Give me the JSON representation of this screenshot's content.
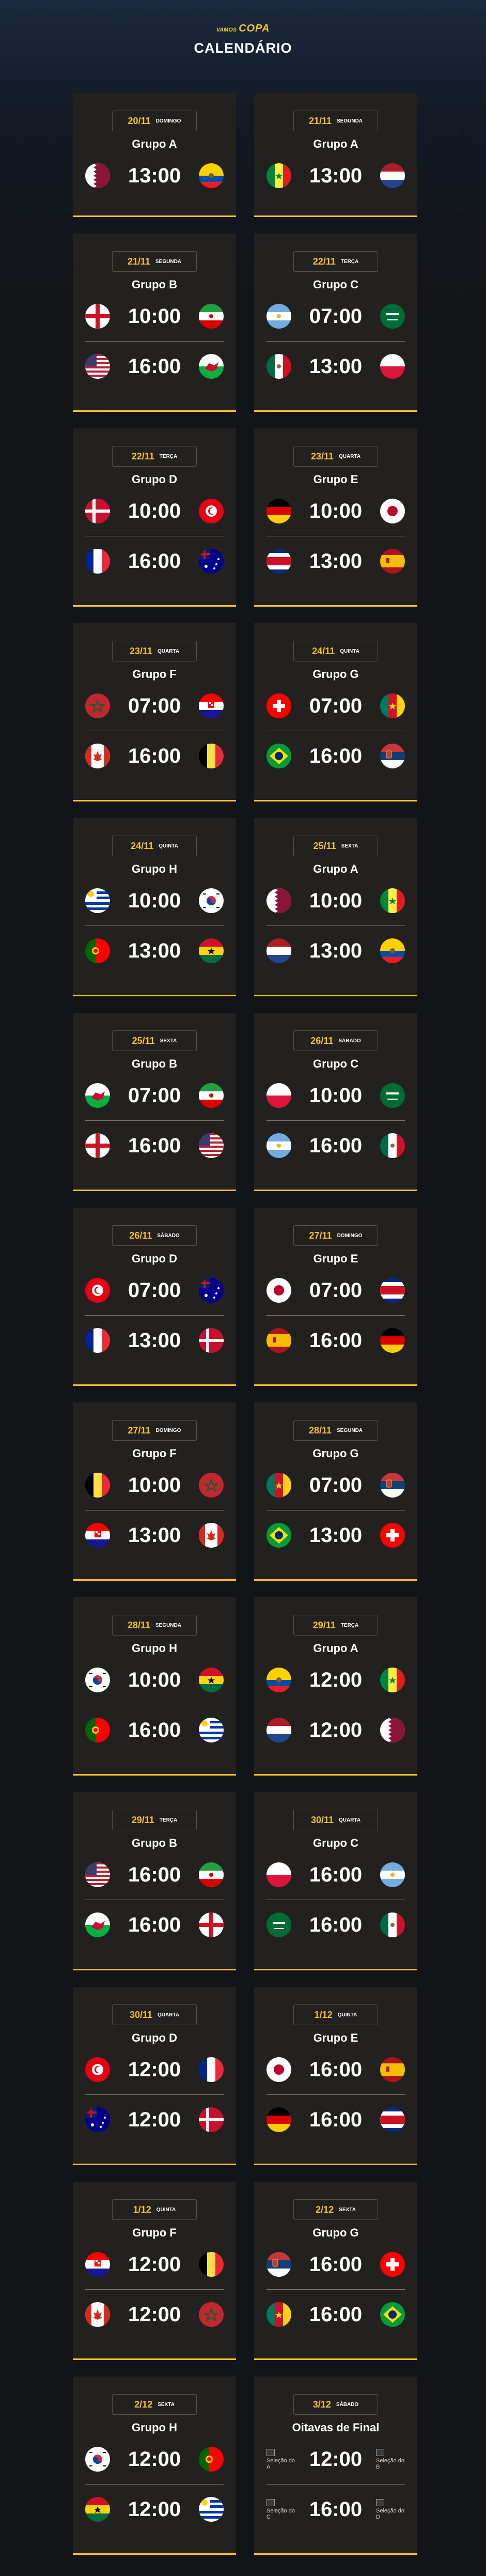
{
  "header": {
    "logo_small": "VAMOS",
    "logo_big": "COPA",
    "title": "CALENDÁRIO"
  },
  "colors": {
    "accent": "#f2c230",
    "card_bg": "#232120",
    "page_bg": "#131417"
  },
  "cards": [
    {
      "date": "20/11",
      "weekday": "DOMINGO",
      "group": "Grupo A",
      "matches": [
        {
          "home": "qatar",
          "time": "13:00",
          "away": "ecuador"
        }
      ]
    },
    {
      "date": "21/11",
      "weekday": "SEGUNDA",
      "group": "Grupo A",
      "matches": [
        {
          "home": "senegal",
          "time": "13:00",
          "away": "netherlands"
        }
      ]
    },
    {
      "date": "21/11",
      "weekday": "SEGUNDA",
      "group": "Grupo B",
      "matches": [
        {
          "home": "england",
          "time": "10:00",
          "away": "iran"
        },
        {
          "home": "usa",
          "time": "16:00",
          "away": "wales"
        }
      ]
    },
    {
      "date": "22/11",
      "weekday": "TERÇA",
      "group": "Grupo C",
      "matches": [
        {
          "home": "argentina",
          "time": "07:00",
          "away": "saudi"
        },
        {
          "home": "mexico",
          "time": "13:00",
          "away": "poland"
        }
      ]
    },
    {
      "date": "22/11",
      "weekday": "TERÇA",
      "group": "Grupo D",
      "matches": [
        {
          "home": "denmark",
          "time": "10:00",
          "away": "tunisia"
        },
        {
          "home": "france",
          "time": "16:00",
          "away": "australia"
        }
      ]
    },
    {
      "date": "23/11",
      "weekday": "QUARTA",
      "group": "Grupo E",
      "matches": [
        {
          "home": "germany",
          "time": "10:00",
          "away": "japan"
        },
        {
          "home": "costarica",
          "time": "13:00",
          "away": "spain"
        }
      ]
    },
    {
      "date": "23/11",
      "weekday": "QUARTA",
      "group": "Grupo F",
      "matches": [
        {
          "home": "morocco",
          "time": "07:00",
          "away": "croatia"
        },
        {
          "home": "canada",
          "time": "16:00",
          "away": "belgium"
        }
      ]
    },
    {
      "date": "24/11",
      "weekday": "QUINTA",
      "group": "Grupo G",
      "matches": [
        {
          "home": "switzerland",
          "time": "07:00",
          "away": "cameroon"
        },
        {
          "home": "brazil",
          "time": "16:00",
          "away": "serbia"
        }
      ]
    },
    {
      "date": "24/11",
      "weekday": "QUINTA",
      "group": "Grupo H",
      "matches": [
        {
          "home": "uruguay",
          "time": "10:00",
          "away": "korea"
        },
        {
          "home": "portugal",
          "time": "13:00",
          "away": "ghana"
        }
      ]
    },
    {
      "date": "25/11",
      "weekday": "SEXTA",
      "group": "Grupo A",
      "matches": [
        {
          "home": "qatar",
          "time": "10:00",
          "away": "senegal"
        },
        {
          "home": "netherlands",
          "time": "13:00",
          "away": "ecuador"
        }
      ]
    },
    {
      "date": "25/11",
      "weekday": "SEXTA",
      "group": "Grupo B",
      "matches": [
        {
          "home": "wales",
          "time": "07:00",
          "away": "iran"
        },
        {
          "home": "england",
          "time": "16:00",
          "away": "usa"
        }
      ]
    },
    {
      "date": "26/11",
      "weekday": "SÁBADO",
      "group": "Grupo C",
      "matches": [
        {
          "home": "poland",
          "time": "10:00",
          "away": "saudi"
        },
        {
          "home": "argentina",
          "time": "16:00",
          "away": "mexico"
        }
      ]
    },
    {
      "date": "26/11",
      "weekday": "SÁBADO",
      "group": "Grupo D",
      "matches": [
        {
          "home": "tunisia",
          "time": "07:00",
          "away": "australia"
        },
        {
          "home": "france",
          "time": "13:00",
          "away": "denmark"
        }
      ]
    },
    {
      "date": "27/11",
      "weekday": "DOMINGO",
      "group": "Grupo E",
      "matches": [
        {
          "home": "japan",
          "time": "07:00",
          "away": "costarica"
        },
        {
          "home": "spain",
          "time": "16:00",
          "away": "germany"
        }
      ]
    },
    {
      "date": "27/11",
      "weekday": "DOMINGO",
      "group": "Grupo F",
      "matches": [
        {
          "home": "belgium",
          "time": "10:00",
          "away": "morocco"
        },
        {
          "home": "croatia",
          "time": "13:00",
          "away": "canada"
        }
      ]
    },
    {
      "date": "28/11",
      "weekday": "SEGUNDA",
      "group": "Grupo G",
      "matches": [
        {
          "home": "cameroon",
          "time": "07:00",
          "away": "serbia"
        },
        {
          "home": "brazil",
          "time": "13:00",
          "away": "switzerland"
        }
      ]
    },
    {
      "date": "28/11",
      "weekday": "SEGUNDA",
      "group": "Grupo H",
      "matches": [
        {
          "home": "korea",
          "time": "10:00",
          "away": "ghana"
        },
        {
          "home": "portugal",
          "time": "16:00",
          "away": "uruguay"
        }
      ]
    },
    {
      "date": "29/11",
      "weekday": "TERÇA",
      "group": "Grupo A",
      "matches": [
        {
          "home": "ecuador",
          "time": "12:00",
          "away": "senegal"
        },
        {
          "home": "netherlands",
          "time": "12:00",
          "away": "qatar"
        }
      ]
    },
    {
      "date": "29/11",
      "weekday": "TERÇA",
      "group": "Grupo B",
      "matches": [
        {
          "home": "usa",
          "time": "16:00",
          "away": "iran"
        },
        {
          "home": "wales",
          "time": "16:00",
          "away": "england"
        }
      ]
    },
    {
      "date": "30/11",
      "weekday": "QUARTA",
      "group": "Grupo C",
      "matches": [
        {
          "home": "poland",
          "time": "16:00",
          "away": "argentina"
        },
        {
          "home": "saudi",
          "time": "16:00",
          "away": "mexico"
        }
      ]
    },
    {
      "date": "30/11",
      "weekday": "QUARTA",
      "group": "Grupo D",
      "matches": [
        {
          "home": "tunisia",
          "time": "12:00",
          "away": "france"
        },
        {
          "home": "australia",
          "time": "12:00",
          "away": "denmark"
        }
      ]
    },
    {
      "date": "1/12",
      "weekday": "QUINTA",
      "group": "Grupo E",
      "matches": [
        {
          "home": "japan",
          "time": "16:00",
          "away": "spain"
        },
        {
          "home": "germany",
          "time": "16:00",
          "away": "costarica"
        }
      ]
    },
    {
      "date": "1/12",
      "weekday": "QUINTA",
      "group": "Grupo F",
      "matches": [
        {
          "home": "croatia",
          "time": "12:00",
          "away": "belgium"
        },
        {
          "home": "canada",
          "time": "12:00",
          "away": "morocco"
        }
      ]
    },
    {
      "date": "2/12",
      "weekday": "SEXTA",
      "group": "Grupo G",
      "matches": [
        {
          "home": "serbia",
          "time": "16:00",
          "away": "switzerland"
        },
        {
          "home": "cameroon",
          "time": "16:00",
          "away": "brazil"
        }
      ]
    },
    {
      "date": "2/12",
      "weekday": "SEXTA",
      "group": "Grupo H",
      "matches": [
        {
          "home": "korea",
          "time": "12:00",
          "away": "portugal"
        },
        {
          "home": "ghana",
          "time": "12:00",
          "away": "uruguay"
        }
      ]
    },
    {
      "date": "3/12",
      "weekday": "SÁBADO",
      "group": "Oitavas de Final",
      "matches": [
        {
          "home": "broken",
          "home_alt": "Seleção do A",
          "time": "12:00",
          "away": "broken",
          "away_alt": "Seleção do B"
        },
        {
          "home": "broken",
          "home_alt": "Seleção do C",
          "time": "16:00",
          "away": "broken",
          "away_alt": "Seleção do D"
        }
      ]
    }
  ]
}
